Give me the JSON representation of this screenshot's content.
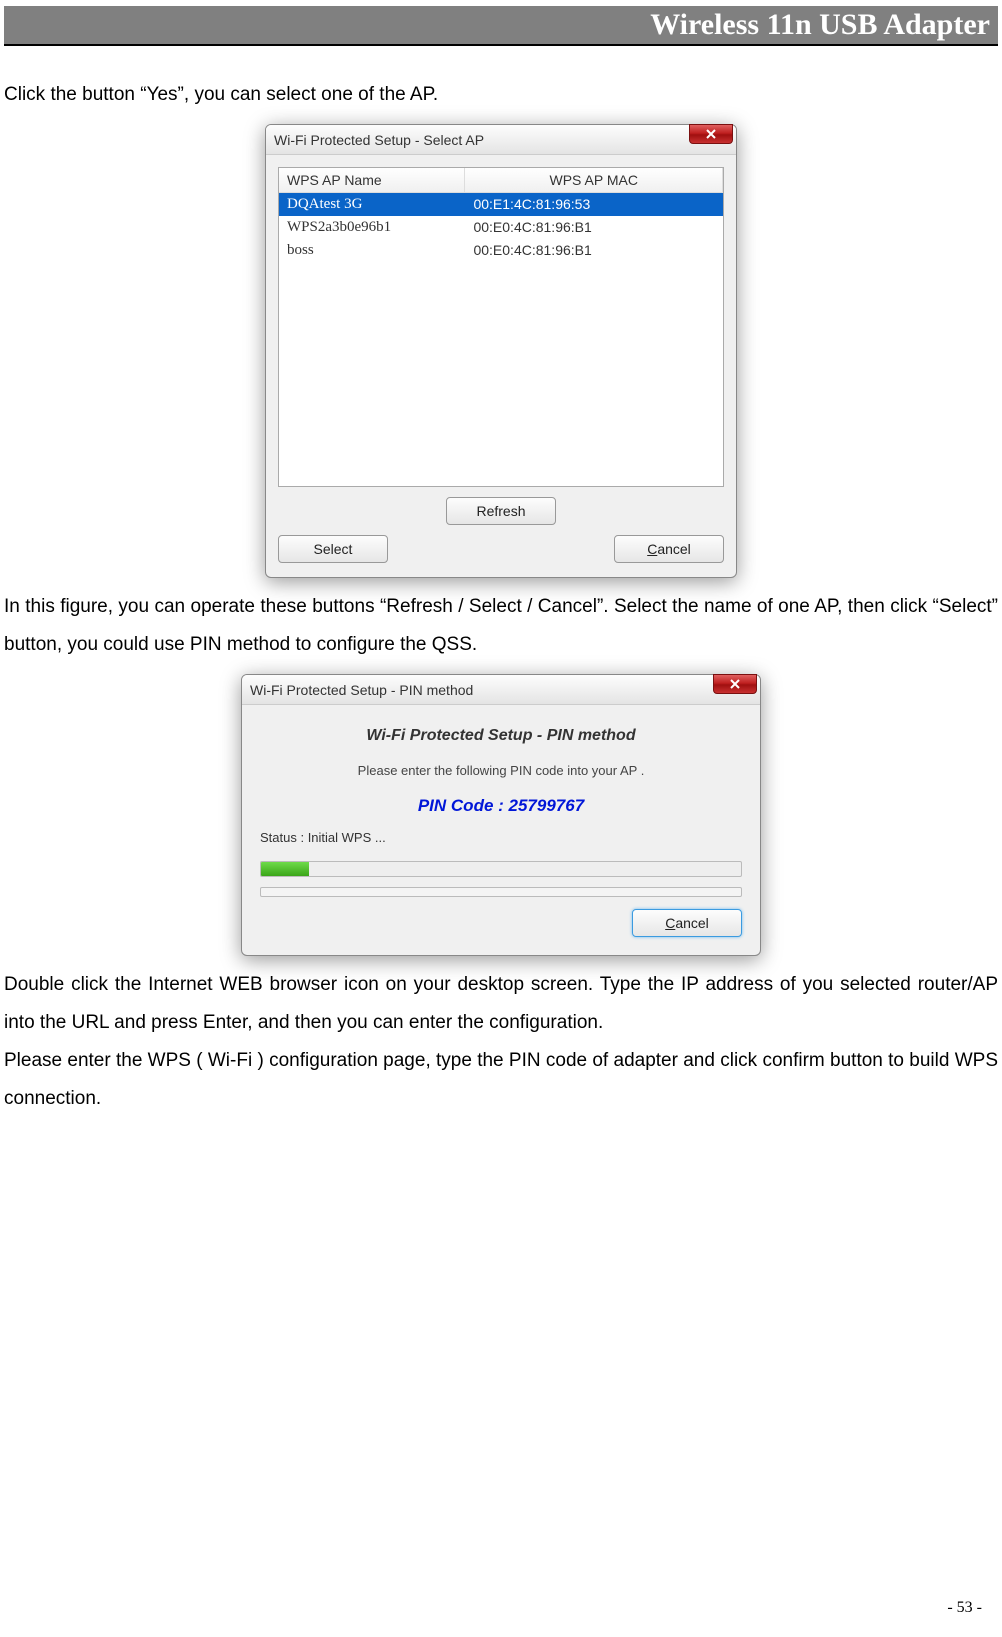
{
  "header": "Wireless 11n USB Adapter",
  "para1": "Click the button “Yes”, you can select one of the AP.",
  "para2": "In this figure, you can operate these buttons “Refresh / Select / Cancel”. Select the name of one AP, then click “Select” button, you could use PIN method to configure the QSS.",
  "para3": "Double click the Internet WEB browser icon on your desktop screen. Type the IP address of you selected router/AP into the URL and press Enter, and then you can enter the configuration.",
  "para4": "Please enter the WPS ( Wi-Fi ) configuration page, type the PIN code of adapter and click confirm button to build WPS connection.",
  "page_number": "- 53 -",
  "dlg_select": {
    "title": "Wi-Fi Protected Setup - Select AP",
    "col_name": "WPS AP Name",
    "col_mac": "WPS AP MAC",
    "rows": [
      {
        "name": "DQAtest  3G",
        "mac": "00:E1:4C:81:96:53",
        "selected": true
      },
      {
        "name": "WPS2a3b0e96b1",
        "mac": "00:E0:4C:81:96:B1",
        "selected": false
      },
      {
        "name": "boss",
        "mac": "00:E0:4C:81:96:B1",
        "selected": false
      }
    ],
    "btn_refresh": "Refresh",
    "btn_select": "Select",
    "btn_cancel": "Cancel"
  },
  "dlg_pin": {
    "title": "Wi-Fi Protected Setup - PIN method",
    "subtitle": "Wi-Fi Protected Setup - PIN method",
    "instruction": "Please enter the following PIN code into your AP .",
    "pin_label": "PIN Code :  25799767",
    "status": "Status : Initial WPS ...",
    "progress_percent": 10,
    "btn_cancel": "Cancel"
  }
}
